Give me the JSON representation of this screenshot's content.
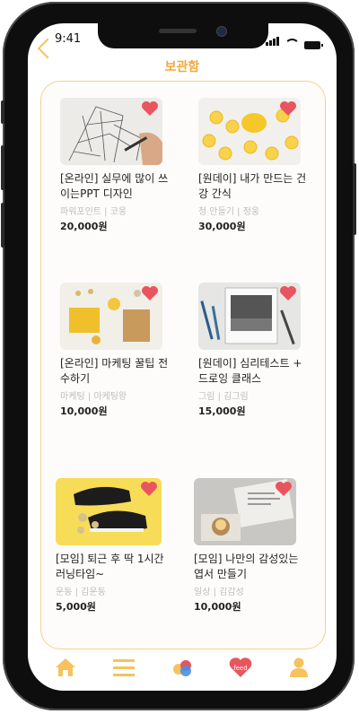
{
  "status": {
    "time": "9:41"
  },
  "header": {
    "title": "보관함"
  },
  "items": [
    {
      "title": "[온라인] 실무에 많이 쓰이는PPT 디자인",
      "meta": "파워포인트 | 코웅",
      "price": "20,000원",
      "image": "sketch-illustration"
    },
    {
      "title": "[원데이] 내가 만드는 건강 간식",
      "meta": "청 만들기 | 정웅",
      "price": "30,000원",
      "image": "lemon-slices"
    },
    {
      "title": "[온라인] 마케팅 꿀팁 전수하기",
      "meta": "마케팅 | 마케팅왕",
      "price": "10,000원",
      "image": "craft-materials"
    },
    {
      "title": "[원데이] 심리테스트 + 드로잉 클래스",
      "meta": "그림 | 김그림",
      "price": "15,000원",
      "image": "drawing-pencils"
    },
    {
      "title": "[모임] 퇴근 후 딱 1시간 러닝타임~",
      "meta": "운동 | 김운동",
      "price": "5,000원",
      "image": "sneakers"
    },
    {
      "title": "[모임] 나만의 감성있는 엽서 만들기",
      "meta": "일상 | 김감성",
      "price": "10,000원",
      "image": "candle-postcards"
    }
  ],
  "tabbar": [
    {
      "name": "home",
      "label": ""
    },
    {
      "name": "menu",
      "label": ""
    },
    {
      "name": "circles",
      "label": ""
    },
    {
      "name": "feed",
      "label": "feed"
    },
    {
      "name": "profile",
      "label": ""
    }
  ],
  "colors": {
    "accent": "#f3a83a",
    "heart": "#e8555f",
    "border": "#f5d28b",
    "icon": "#f7c25d"
  }
}
